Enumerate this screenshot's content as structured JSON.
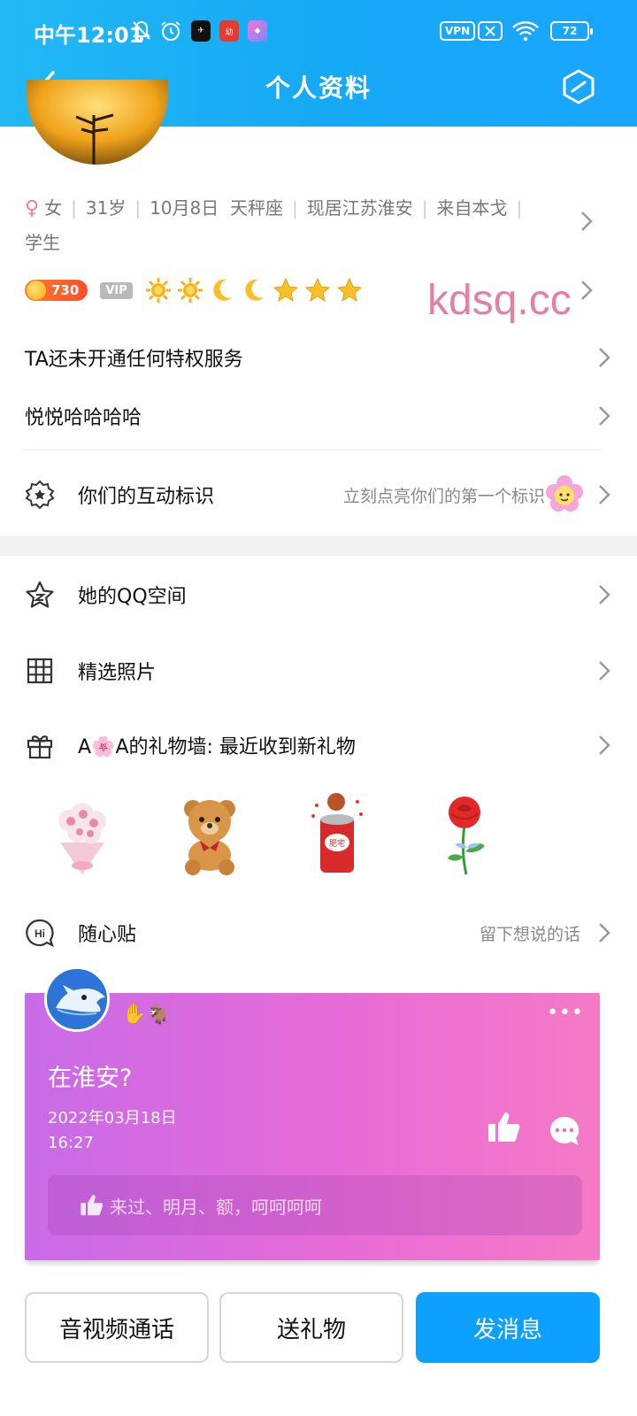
{
  "status_bar": {
    "time": "中午12:01",
    "vpn": "VPN",
    "battery": "72"
  },
  "nav": {
    "title": "个人资料"
  },
  "profile": {
    "gender": "女",
    "age": "31岁",
    "birthday": "10月8日",
    "zodiac": "天秤座",
    "location": "现居江苏淮安",
    "hometown": "来自本戈",
    "occupation": "学生",
    "level": "730",
    "vip": "VIP"
  },
  "watermark": "kdsq.cc",
  "rows": {
    "privilege": "TA还未开通任何特权服务",
    "signature": "悦悦哈哈哈哈",
    "interaction_label": "你们的互动标识",
    "interaction_hint": "立刻点亮你们的第一个标识",
    "qzone": "她的QQ空间",
    "photos": "精选照片",
    "gift_wall": "A🌸A的礼物墙: 最近收到新礼物",
    "sticky_label": "随心贴",
    "sticky_hint": "留下想说的话"
  },
  "gifts": [
    "bouquet",
    "teddy-bear",
    "soda-can",
    "rose"
  ],
  "card": {
    "emojis": "✋🐐",
    "more": "•••",
    "title": "在淮安?",
    "date": "2022年03月18日",
    "time": "16:27",
    "reply": "来过、明月、额，呵呵呵呵"
  },
  "buttons": {
    "call": "音视频通话",
    "gift": "送礼物",
    "message": "发消息"
  },
  "colors": {
    "header": "#16a9f5",
    "primary_button": "#0ea0ff",
    "card_gradient_start": "#c86be8",
    "card_gradient_end": "#f57ac6",
    "watermark": "#e57fa0"
  }
}
